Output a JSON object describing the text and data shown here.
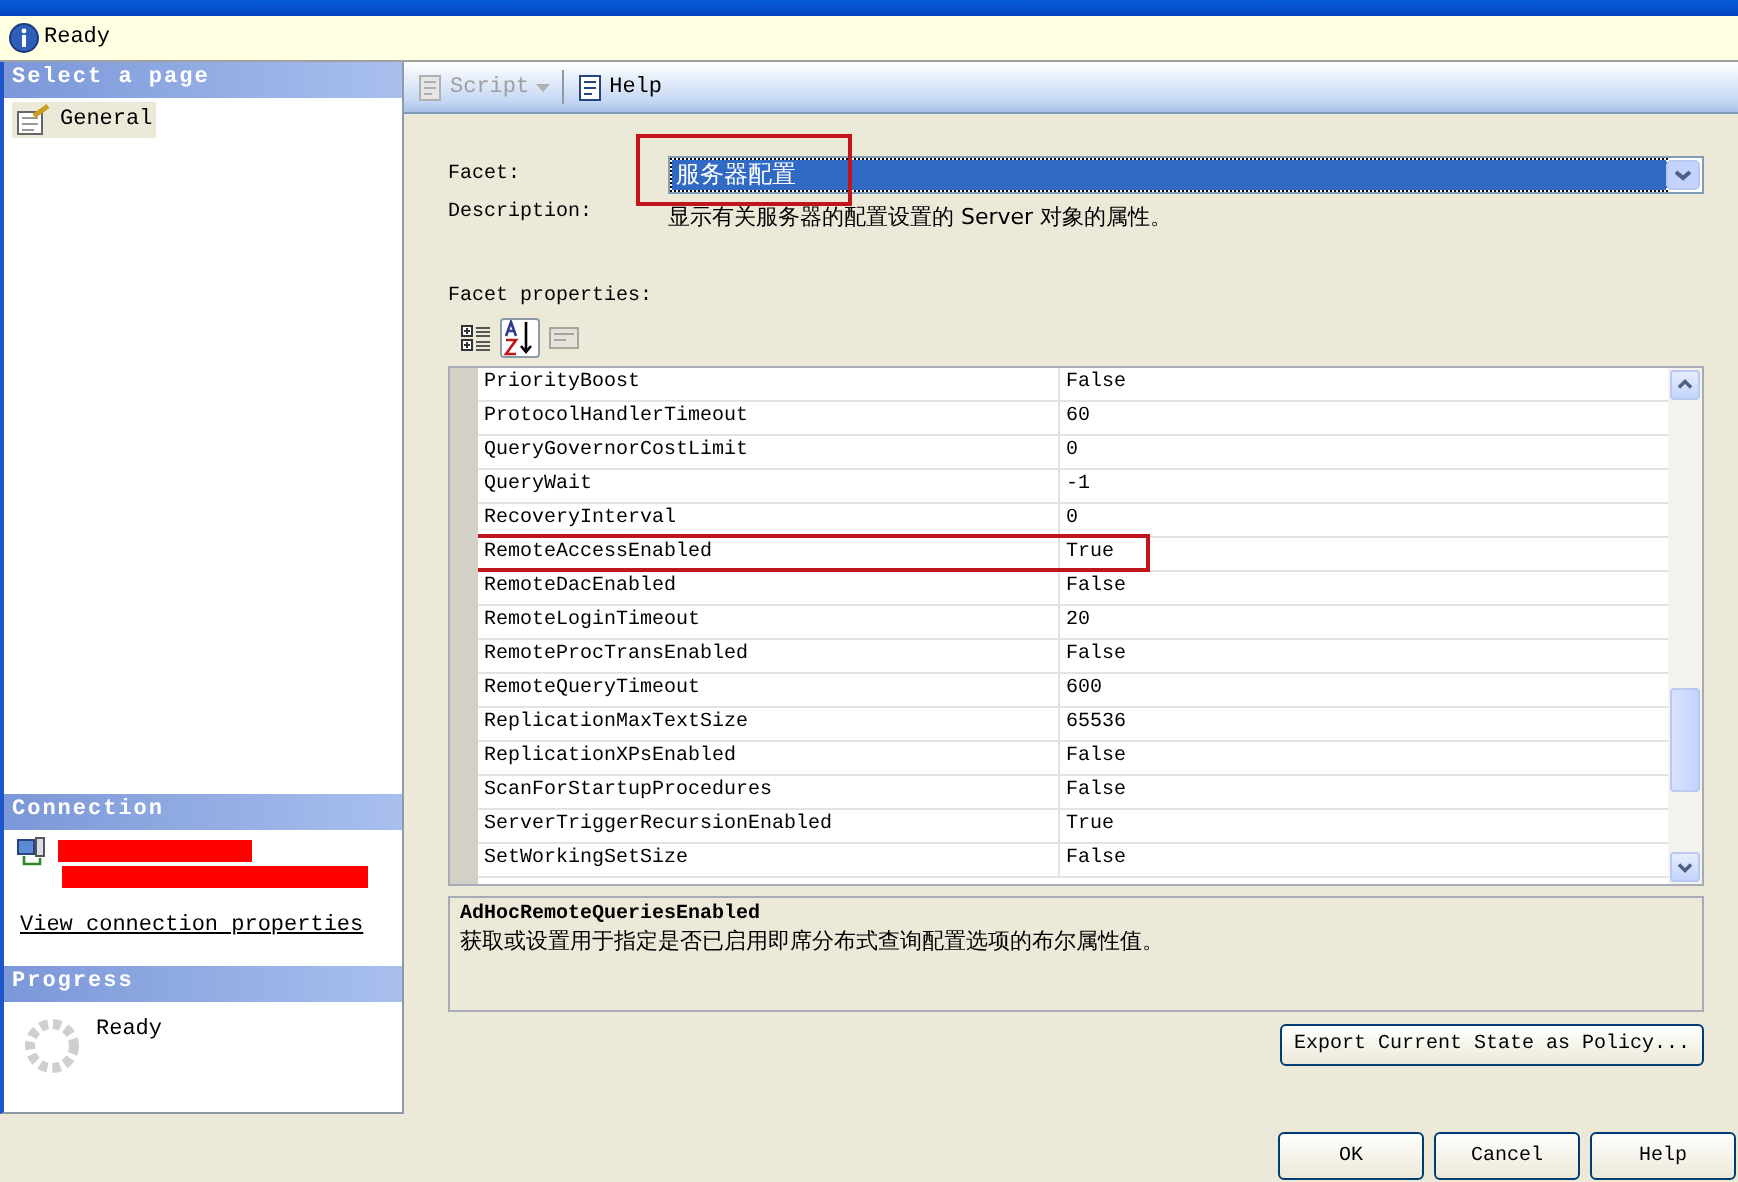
{
  "status": {
    "text": "Ready"
  },
  "pages": {
    "header": "Select a page",
    "items": [
      {
        "label": "General",
        "selected": true
      }
    ]
  },
  "connection": {
    "header": "Connection",
    "redacted": true,
    "link": "View connection properties"
  },
  "progress": {
    "header": "Progress",
    "status": "Ready"
  },
  "toolbar": [
    {
      "label": "Script",
      "kind": "dropdown",
      "disabled": true
    },
    {
      "label": "Help",
      "kind": "plain",
      "disabled": false
    }
  ],
  "facet": {
    "label": "Facet:",
    "value": "服务器配置",
    "annotated": true
  },
  "description": {
    "label": "Description:",
    "text": "显示有关服务器的配置设置的 Server 对象的属性。"
  },
  "properties": {
    "label": "Facet properties:",
    "sort_buttons": [
      {
        "kind": "categorized",
        "selected": false
      },
      {
        "kind": "alphabetical",
        "selected": true
      },
      {
        "kind": "pages",
        "selected": false
      }
    ],
    "rows": [
      {
        "name": "PriorityBoost",
        "value": "False",
        "annotated": false
      },
      {
        "name": "ProtocolHandlerTimeout",
        "value": "60",
        "annotated": false
      },
      {
        "name": "QueryGovernorCostLimit",
        "value": "0",
        "annotated": false
      },
      {
        "name": "QueryWait",
        "value": "-1",
        "annotated": false
      },
      {
        "name": "RecoveryInterval",
        "value": "0",
        "annotated": false
      },
      {
        "name": "RemoteAccessEnabled",
        "value": "True",
        "annotated": true
      },
      {
        "name": "RemoteDacEnabled",
        "value": "False",
        "annotated": false
      },
      {
        "name": "RemoteLoginTimeout",
        "value": "20",
        "annotated": false
      },
      {
        "name": "RemoteProcTransEnabled",
        "value": "False",
        "annotated": false
      },
      {
        "name": "RemoteQueryTimeout",
        "value": "600",
        "annotated": false
      },
      {
        "name": "ReplicationMaxTextSize",
        "value": "65536",
        "annotated": false
      },
      {
        "name": "ReplicationXPsEnabled",
        "value": "False",
        "annotated": false
      },
      {
        "name": "ScanForStartupProcedures",
        "value": "False",
        "annotated": false
      },
      {
        "name": "ServerTriggerRecursionEnabled",
        "value": "True",
        "annotated": false
      },
      {
        "name": "SetWorkingSetSize",
        "value": "False",
        "annotated": false
      }
    ]
  },
  "help_panel": {
    "title": "AdHocRemoteQueriesEnabled",
    "text": "获取或设置用于指定是否已启用即席分布式查询配置选项的布尔属性值。"
  },
  "export_button": "Export Current State as Policy...",
  "buttons": [
    "OK",
    "Cancel",
    "Help"
  ]
}
